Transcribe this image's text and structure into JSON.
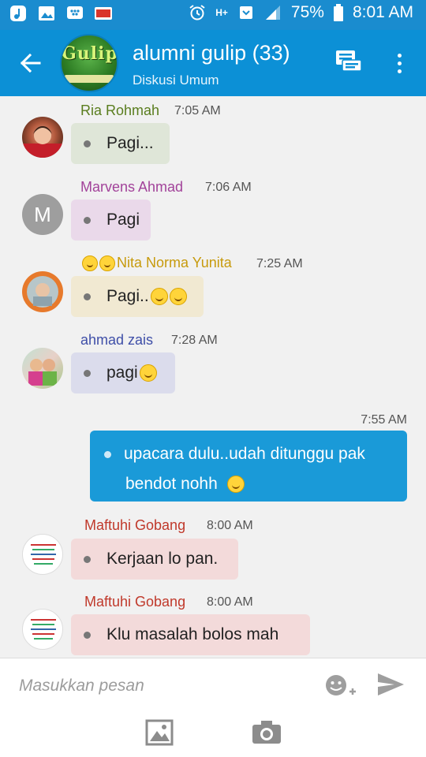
{
  "status_bar": {
    "battery": "75%",
    "time": "8:01 AM",
    "network": "H+"
  },
  "header": {
    "title": "alumni gulip (33)",
    "subtitle": "Diskusi Umum",
    "avatar_logo_text": "Gulip"
  },
  "messages": [
    {
      "sender": "Ria Rohmah",
      "time": "7:05 AM",
      "text": "Pagi...",
      "sender_color": "#5a7d1e",
      "bubble_color": "#dfe6d8"
    },
    {
      "sender": "Marvens Ahmad",
      "time": "7:06 AM",
      "text": "Pagi",
      "sender_color": "#a2439a",
      "bubble_color": "#ead9ea",
      "avatar_letter": "M"
    },
    {
      "sender": "Nita Norma Yunita",
      "time": "7:25 AM",
      "text": "Pagi..",
      "sender_color": "#c79a0c",
      "bubble_color": "#f1e9d2"
    },
    {
      "sender": "ahmad zais",
      "time": "7:28 AM",
      "text": "pagi",
      "sender_color": "#3f4fa8",
      "bubble_color": "#dbdcec"
    },
    {
      "own": true,
      "time": "7:55 AM",
      "line1": "upacara dulu..udah ditunggu pak",
      "line2": "bendot nohh"
    },
    {
      "sender": "Maftuhi Gobang",
      "time": "8:00 AM",
      "text": "Kerjaan lo pan.",
      "sender_color": "#c0392b",
      "bubble_color": "#f3dada"
    },
    {
      "sender": "Maftuhi Gobang",
      "time": "8:00 AM",
      "text": "Klu masalah bolos mah",
      "sender_color": "#c0392b",
      "bubble_color": "#f3dada"
    }
  ],
  "composer": {
    "placeholder": "Masukkan pesan"
  },
  "icons": {
    "back": "arrow-left-icon",
    "topics": "topics-icon",
    "more": "more-vert-icon",
    "emoji": "emoji-add-icon",
    "send": "send-icon",
    "image": "image-icon",
    "camera": "camera-icon"
  },
  "colors": {
    "status_bar": "#1a8ccf",
    "app_bar": "#0c90d6",
    "own_bubble": "#1a9ad8",
    "background": "#f1f1f1"
  }
}
